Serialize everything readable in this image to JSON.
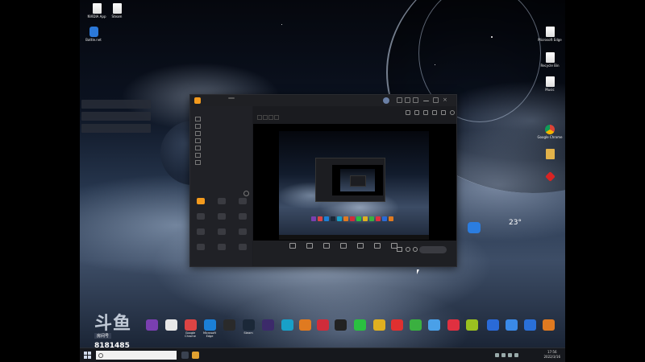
{
  "desktop_icons_left": [
    {
      "label": "NVIDIA App",
      "kind": "doc"
    },
    {
      "label": "Steam",
      "kind": "doc"
    },
    {
      "label": "Battle.net",
      "kind": "blue"
    }
  ],
  "desktop_icons_right": [
    {
      "label": "Microsoft Edge",
      "kind": "doc"
    },
    {
      "label": "Recycle Bin",
      "kind": "doc"
    },
    {
      "label": "Music",
      "kind": "doc"
    },
    {
      "label": "Google Chrome",
      "kind": "chrome"
    },
    {
      "label": "",
      "kind": "folder"
    },
    {
      "label": "",
      "kind": "red"
    }
  ],
  "notifications": [
    "",
    "",
    ""
  ],
  "weather": {
    "temp": "23°"
  },
  "app": {
    "name": "",
    "version": "",
    "sidebar_tabs": [
      "",
      "",
      "",
      ""
    ],
    "scenes": [
      {
        "label": "",
        "dim": false
      },
      {
        "label": "",
        "dim": false
      },
      {
        "label": "",
        "dim": false
      },
      {
        "label": "",
        "dim": true
      },
      {
        "label": "",
        "dim": true
      },
      {
        "label": "",
        "dim": true
      },
      {
        "label": "",
        "dim": true
      }
    ],
    "tools_title": "",
    "tools": [
      {
        "label": "",
        "hot": true
      },
      {
        "label": "",
        "hot": false
      },
      {
        "label": "",
        "hot": false
      },
      {
        "label": "",
        "hot": false
      },
      {
        "label": "",
        "hot": false
      },
      {
        "label": "",
        "hot": false
      },
      {
        "label": "",
        "hot": false
      },
      {
        "label": "",
        "hot": false
      },
      {
        "label": "",
        "hot": false
      },
      {
        "label": "",
        "hot": false
      },
      {
        "label": "",
        "hot": false
      },
      {
        "label": "",
        "hot": false
      }
    ],
    "sidebar_footer": "",
    "scene_name": "",
    "scene_badge": "",
    "sub_tags": [
      "",
      "",
      "",
      ""
    ],
    "controls": [
      "",
      "",
      "",
      "",
      "",
      "",
      ""
    ],
    "live_button": ""
  },
  "dock_icons": [
    {
      "label": "",
      "color": "#7a3fb0"
    },
    {
      "label": "",
      "color": "#e8e8e8"
    },
    {
      "label": "Google Chrome",
      "color": "#d44"
    },
    {
      "label": "Microsoft Edge",
      "color": "#1b7fd6"
    },
    {
      "label": "",
      "color": "#2a2a2a"
    },
    {
      "label": "Steam",
      "color": "#1b2838"
    },
    {
      "label": "",
      "color": "#3c2a6a"
    },
    {
      "label": "",
      "color": "#18a0c8"
    },
    {
      "label": "",
      "color": "#e07a20"
    },
    {
      "label": "",
      "color": "#d02c3a"
    },
    {
      "label": "",
      "color": "#222"
    },
    {
      "label": "",
      "color": "#2ac040"
    },
    {
      "label": "",
      "color": "#e0b020"
    },
    {
      "label": "",
      "color": "#e03030"
    },
    {
      "label": "",
      "color": "#3ab040"
    },
    {
      "label": "",
      "color": "#4aa0e8"
    },
    {
      "label": "",
      "color": "#e03040"
    },
    {
      "label": "",
      "color": "#9ac020"
    },
    {
      "label": "",
      "color": "#2a6ad8"
    },
    {
      "label": "",
      "color": "#3a8ae8"
    },
    {
      "label": "",
      "color": "#2a70d8"
    },
    {
      "label": "",
      "color": "#e07a20"
    }
  ],
  "taskbar": {
    "search_placeholder": "",
    "time": "17:56",
    "date": "2022/3/16"
  },
  "watermark": {
    "logo": "斗鱼",
    "room_label": "房间号",
    "room_id": "8181485"
  }
}
